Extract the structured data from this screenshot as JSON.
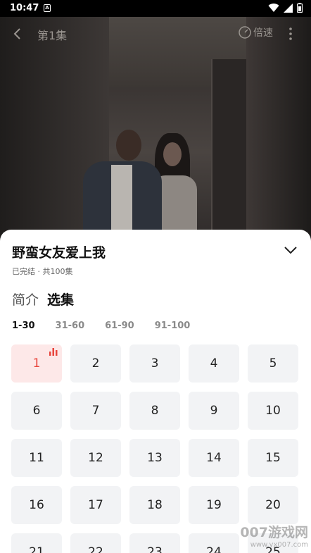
{
  "status_bar": {
    "time": "10:47",
    "notification_badge": "A"
  },
  "player": {
    "episode_title": "第1集",
    "speed_label": "倍速"
  },
  "sheet": {
    "title": "野蛮女友爱上我",
    "meta": "已完结 · 共100集",
    "tabs": [
      {
        "label": "简介",
        "active": false
      },
      {
        "label": "选集",
        "active": true
      }
    ],
    "ranges": [
      {
        "label": "1-30",
        "active": true
      },
      {
        "label": "31-60",
        "active": false
      },
      {
        "label": "61-90",
        "active": false
      },
      {
        "label": "91-100",
        "active": false
      }
    ],
    "episodes": [
      "1",
      "2",
      "3",
      "4",
      "5",
      "6",
      "7",
      "8",
      "9",
      "10",
      "11",
      "12",
      "13",
      "14",
      "15",
      "16",
      "17",
      "18",
      "19",
      "20",
      "21",
      "22",
      "23",
      "24",
      "25"
    ],
    "current_episode": "1"
  },
  "watermark": {
    "line1": "007游戏网",
    "line2": "www.yx007.com"
  },
  "colors": {
    "accent": "#e8453c",
    "active_cell_bg": "#fde8e8",
    "cell_bg": "#f2f3f5"
  },
  "icons": [
    "back-arrow-icon",
    "speed-icon",
    "more-vertical-icon",
    "chevron-down-icon",
    "playing-bars-icon",
    "wifi-icon",
    "signal-icon",
    "battery-icon"
  ]
}
